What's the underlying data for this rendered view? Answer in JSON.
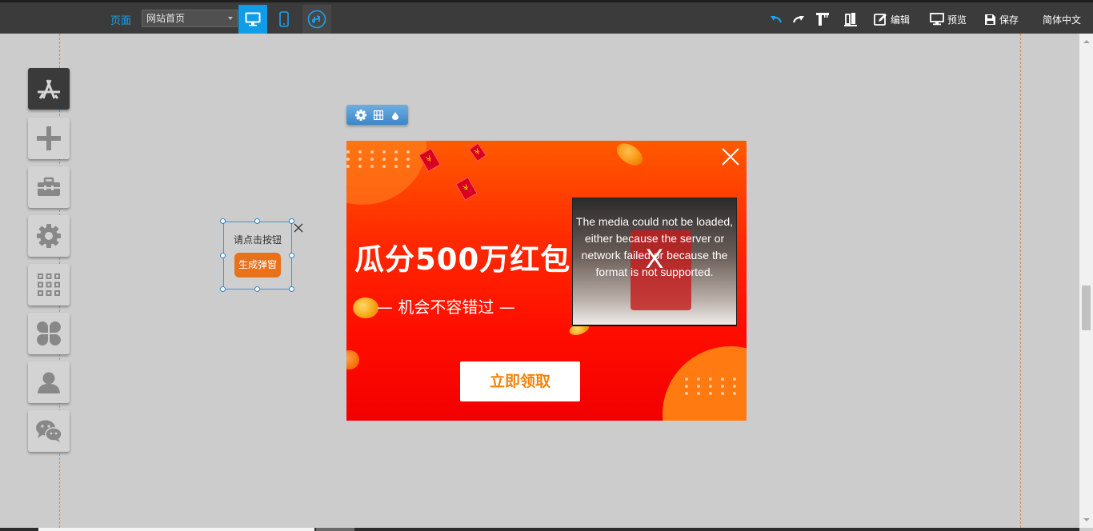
{
  "toolbar": {
    "page_label": "页面",
    "page_select": "网站首页",
    "edit_label": "编辑",
    "preview_label": "预览",
    "save_label": "保存",
    "language": "简体中文"
  },
  "canvas_element": {
    "title": "请点击按钮",
    "button_label": "生成弹窗"
  },
  "popup": {
    "headline": "瓜分500万红包",
    "subline": "— 机会不容错过 —",
    "claim_button": "立即领取",
    "media_error": "The media could not be loaded, either because the server or network failed or because the format is not supported.",
    "media_close": "X"
  },
  "sidebar": {
    "items": [
      "app-store-icon",
      "plus-icon",
      "toolbox-icon",
      "gear-icon",
      "grid-icon",
      "clover-icon",
      "user-icon",
      "wechat-icon"
    ]
  },
  "colors": {
    "accent": "#0f9de8",
    "toolbar_bg": "#3b3b3b",
    "canvas_bg": "#cccccc",
    "popup_red": "#ff1a00",
    "claim_text": "#f2830c"
  }
}
